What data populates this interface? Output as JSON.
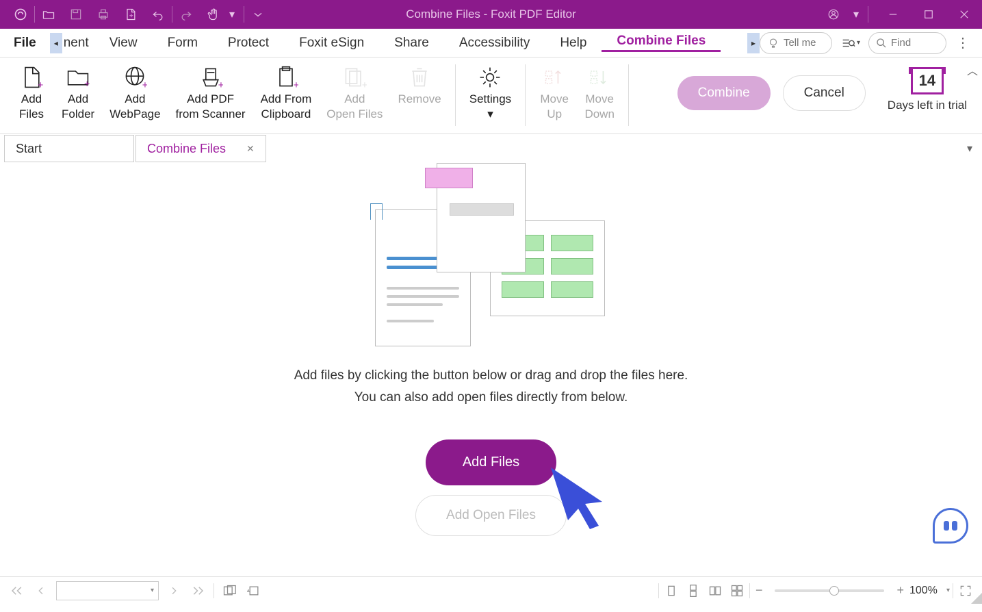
{
  "window": {
    "title": "Combine Files - Foxit PDF Editor"
  },
  "quickaccess": {
    "icons": [
      "app-logo",
      "open",
      "save",
      "print",
      "create",
      "undo",
      "redo",
      "hand",
      "more-qat"
    ]
  },
  "menu": {
    "file": "File",
    "partial": "nent",
    "items": [
      "View",
      "Form",
      "Protect",
      "Foxit eSign",
      "Share",
      "Accessibility",
      "Help",
      "Combine Files"
    ],
    "active_index": 7,
    "tellme_placeholder": "Tell me",
    "find_placeholder": "Find"
  },
  "ribbon": {
    "group1": [
      {
        "label": "Add\nFiles",
        "icon": "file-plus"
      },
      {
        "label": "Add\nFolder",
        "icon": "folder-plus"
      },
      {
        "label": "Add\nWebPage",
        "icon": "globe-plus"
      },
      {
        "label": "Add PDF\nfrom Scanner",
        "icon": "scanner-plus"
      },
      {
        "label": "Add From\nClipboard",
        "icon": "clipboard-plus"
      },
      {
        "label": "Add\nOpen Files",
        "icon": "openfiles-plus",
        "disabled": true
      },
      {
        "label": "Remove",
        "icon": "trash",
        "disabled": true
      }
    ],
    "group2": [
      {
        "label": "Settings",
        "icon": "gear",
        "dropdown": true
      }
    ],
    "group3": [
      {
        "label": "Move\nUp",
        "icon": "move-up",
        "disabled": true
      },
      {
        "label": "Move\nDown",
        "icon": "move-down",
        "disabled": true
      }
    ],
    "combine": "Combine",
    "cancel": "Cancel",
    "trial_days": "14",
    "trial_text": "Days left in trial"
  },
  "doctabs": {
    "tabs": [
      {
        "label": "Start",
        "active": false
      },
      {
        "label": "Combine Files",
        "active": true
      }
    ]
  },
  "main": {
    "line1": "Add files by clicking the button below or drag and drop the files here.",
    "line2": "You can also add open files directly from below.",
    "addfiles": "Add Files",
    "addopen": "Add Open Files"
  },
  "statusbar": {
    "zoom": "100%"
  }
}
